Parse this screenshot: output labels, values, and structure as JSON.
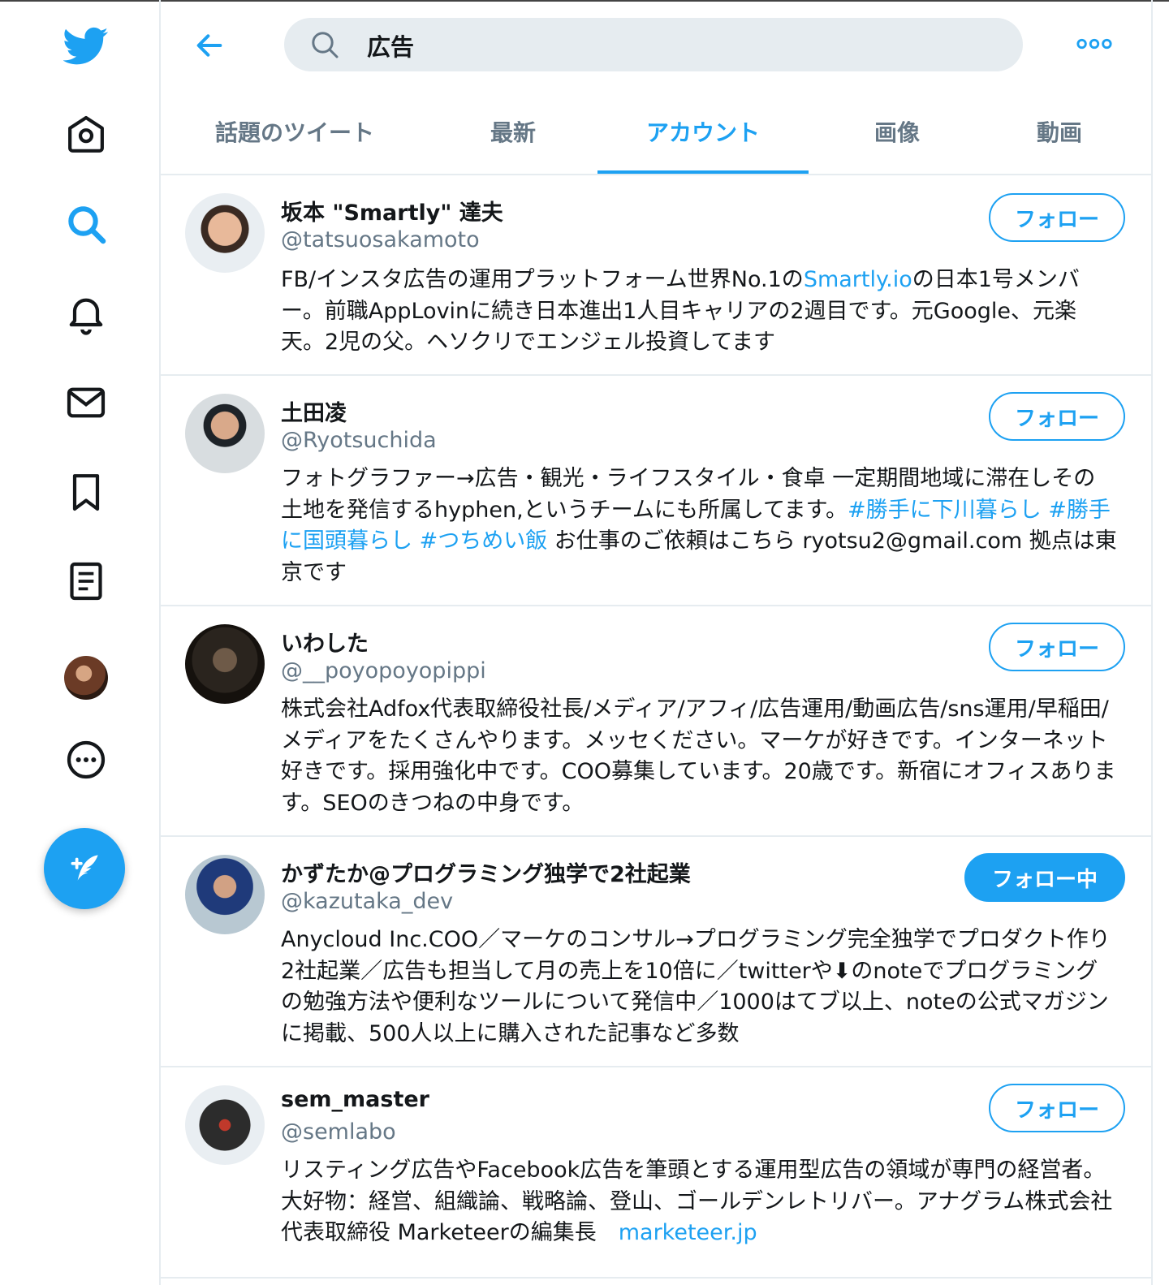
{
  "search": {
    "query": "広告"
  },
  "tabs": [
    {
      "label": "話題のツイート"
    },
    {
      "label": "最新"
    },
    {
      "label": "アカウント"
    },
    {
      "label": "画像"
    },
    {
      "label": "動画"
    }
  ],
  "colors": {
    "accent": "#1da1f2",
    "muted": "#657786",
    "divider": "#e6ecf0",
    "text": "#14171a"
  },
  "nav_icons": [
    "twitter-logo-icon",
    "home-icon",
    "search-icon",
    "bell-icon",
    "mail-icon",
    "bookmark-icon",
    "list-icon",
    "avatar",
    "more-circle-icon",
    "compose-icon"
  ],
  "results": [
    {
      "name": "坂本 \"Smartly\" 達夫",
      "handle": "@tatsuosakamoto",
      "bio_parts": [
        "FB/インスタ広告の運用プラットフォーム世界No.1の",
        "Smartly.io",
        "の日本1号メンバー。前職AppLovinに続き日本進出1人目キャリアの2週目です。元Google、元楽天。2児の父。ヘソクリでエンジェル投資してます"
      ],
      "follow_label": "フォロー"
    },
    {
      "name": "土田凌",
      "handle": "@Ryotsuchida",
      "bio_parts": [
        "フォトグラファー→広告・観光・ライフスタイル・食卓 一定期間地域に滞在しその土地を発信するhyphen,というチームにも所属してます。",
        "#勝手に下川暮らし",
        " ",
        "#勝手に国頭暮らし",
        " ",
        "#つちめい飯",
        " お仕事のご依頼はこちら ryotsu2@gmail.com 拠点は東京です"
      ],
      "follow_label": "フォロー"
    },
    {
      "name": "いわした",
      "handle": "@__poyopoyopippi",
      "bio_parts": [
        "株式会社Adfox代表取締役社長/メディア/アフィ/広告運用/動画広告/sns運用/早稲田/メディアをたくさんやります。メッセください。マーケが好きです。インターネット好きです。採用強化中です。COO募集しています。20歳です。新宿にオフィスあります。SEOのきつねの中身です。"
      ],
      "follow_label": "フォロー"
    },
    {
      "name": "かずたか@プログラミング独学で2社起業",
      "handle": "@kazutaka_dev",
      "bio_parts": [
        "Anycloud Inc.COO／マーケのコンサル→プログラミング完全独学でプロダクト作り2社起業／広告も担当して月の売上を10倍に／twitterや⬇のnoteでプログラミングの勉強方法や便利なツールについて発信中／1000はてブ以上、noteの公式マガジンに掲載、500人以上に購入された記事など多数"
      ],
      "follow_label": "フォロー中"
    },
    {
      "name": "sem_master",
      "handle": "@semlabo",
      "bio_parts": [
        "リスティング広告やFacebook広告を筆頭とする運用型広告の領域が専門の経営者。大好物：経営、組織論、戦略論、登山、ゴールデンレトリバー。アナグラム株式会社　代表取締役 Marketeerの編集長　",
        "marketeer.jp"
      ],
      "follow_label": "フォロー"
    }
  ]
}
